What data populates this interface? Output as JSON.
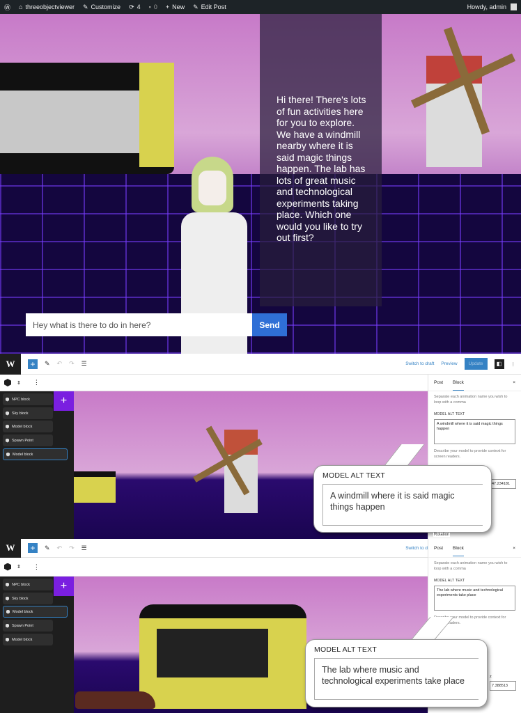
{
  "admin_bar": {
    "site": "threeobjectviewer",
    "customize": "Customize",
    "updates": "4",
    "comments": "0",
    "new": "New",
    "edit_post": "Edit Post",
    "howdy": "Howdy, admin"
  },
  "scene": {
    "npc_message": "Hi there! There's lots of fun activities here for you to explore. We have a windmill nearby where it is said magic things happen. The lab has lots of great music and technological experiments taking place. Which one would you like to try out first?",
    "chat_input_value": "Hey what is there to do in here?",
    "send_label": "Send"
  },
  "editor": {
    "switch_to_draft": "Switch to draft",
    "preview": "Preview",
    "update": "Update",
    "tabs": {
      "post": "Post",
      "block": "Block",
      "close": "×"
    },
    "animation_help": "Separate each animation name you wish to loop with a comma",
    "alt_label": "MODEL ALT TEXT",
    "alt_help": "Describe your model to provide context for screen readers.",
    "z_label": "z",
    "rotation_label": "Rotation",
    "blocks": [
      "NPC block",
      "Sky block",
      "Model block",
      "Spawn Point",
      "Model block"
    ]
  },
  "panel1": {
    "alt_text": "A windmill where it is said magic things happen",
    "z_value": "47.234181",
    "selected_index": 4
  },
  "panel2": {
    "alt_text": "The lab where music and technological experiments take place",
    "z_value": "7.388513",
    "selected_index": 2
  },
  "colors": {
    "admin_bar": "#1d2327",
    "accent": "#3582c4",
    "add_block": "#7a1fe0",
    "send": "#2f6fd6"
  }
}
